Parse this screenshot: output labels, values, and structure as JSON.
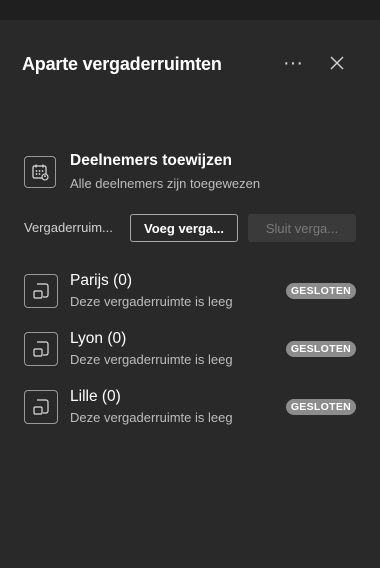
{
  "header": {
    "title": "Aparte vergaderruimten",
    "more_label": "···"
  },
  "assign": {
    "title": "Deelnemers toewijzen",
    "subtitle": "Alle deelnemers zijn toegewezen"
  },
  "rooms_bar": {
    "label": "Vergaderruim...",
    "add_button": "Voeg verga...",
    "close_button": "Sluit verga..."
  },
  "rooms": [
    {
      "name": "Parijs (0)",
      "status": "Deze vergaderruimte is leeg",
      "badge": "GESLOTEN"
    },
    {
      "name": "Lyon (0)",
      "status": "Deze vergaderruimte is leeg",
      "badge": "GESLOTEN"
    },
    {
      "name": "Lille (0)",
      "status": "Deze vergaderruimte is leeg",
      "badge": "GESLOTEN"
    }
  ],
  "colors": {
    "background": "#292929",
    "badge": "#8c8c8c",
    "text_secondary": "#bdbdbd"
  }
}
